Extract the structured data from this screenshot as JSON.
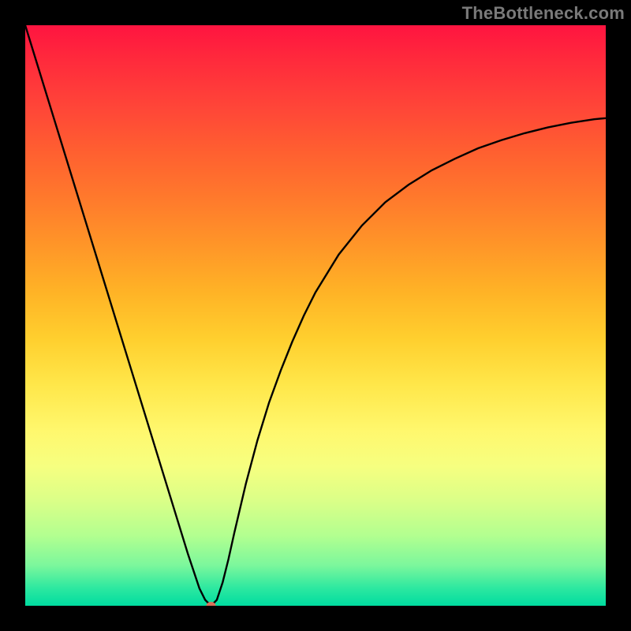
{
  "watermark": "TheBottleneck.com",
  "colors": {
    "frame": "#000000",
    "curve": "#000000",
    "marker": "#d9705a",
    "gradient_top": "#ff1440",
    "gradient_bottom": "#00dca0"
  },
  "chart_data": {
    "type": "line",
    "title": "",
    "xlabel": "",
    "ylabel": "",
    "xlim": [
      0,
      100
    ],
    "ylim": [
      0,
      100
    ],
    "series": [
      {
        "name": "bottleneck-curve",
        "x": [
          0,
          2,
          4,
          6,
          8,
          10,
          12,
          14,
          16,
          18,
          20,
          22,
          24,
          26,
          28,
          30,
          31,
          32,
          33,
          34,
          35,
          36,
          38,
          40,
          42,
          44,
          46,
          48,
          50,
          54,
          58,
          62,
          66,
          70,
          74,
          78,
          82,
          86,
          90,
          94,
          98,
          100
        ],
        "y": [
          100,
          93.5,
          87,
          80.5,
          74,
          67.5,
          61,
          54.5,
          48,
          41.5,
          35,
          28.5,
          22,
          15.5,
          9,
          3,
          1,
          0,
          1,
          4,
          8,
          12.5,
          21,
          28.5,
          35,
          40.5,
          45.5,
          50,
          54,
          60.5,
          65.5,
          69.5,
          72.5,
          75,
          77,
          78.8,
          80.2,
          81.4,
          82.4,
          83.2,
          83.8,
          84
        ]
      }
    ],
    "minimum_point": {
      "x": 32,
      "y": 0
    }
  }
}
